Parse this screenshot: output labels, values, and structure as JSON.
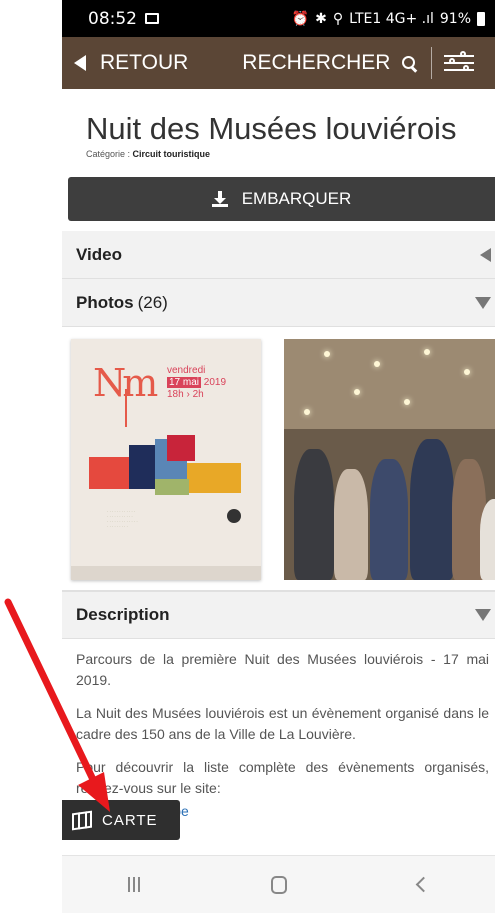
{
  "status_bar": {
    "time": "08:52",
    "indicators": "LTE1 4G+ .ıl",
    "battery": "91%"
  },
  "navbar": {
    "back_label": "RETOUR",
    "search_label": "RECHERCHER"
  },
  "header": {
    "title": "Nuit des Musées louviérois",
    "category_prefix": "Catégorie : ",
    "category_value": "Circuit touristique"
  },
  "embark_button": {
    "label": "EMBARQUER"
  },
  "sections": {
    "video": {
      "label": "Video"
    },
    "photos": {
      "label": "Photos",
      "count": "(26)"
    },
    "description": {
      "label": "Description"
    }
  },
  "poster": {
    "day": "vendredi",
    "date": "17 mai",
    "year": "2019",
    "hours": "18h › 2h"
  },
  "description": {
    "paragraph_1": "Parcours de la première Nuit des Musées louviérois - 17 mai 2019.",
    "paragraph_2": "La Nuit des Musées louviérois est un évènement organisé dans le cadre des 150 ans de la Ville de La Louvière.",
    "paragraph_3": "Pour découvrir la liste complète des évènements organisés, rendez-vous sur le site:",
    "link": "www.lalouviere.be"
  },
  "carte_button": {
    "label": "CARTE"
  },
  "colors": {
    "navbar": "#5b4636",
    "embark": "#3e3e3e",
    "annotation_arrow": "#e8191d",
    "link": "#2a6fb5"
  }
}
